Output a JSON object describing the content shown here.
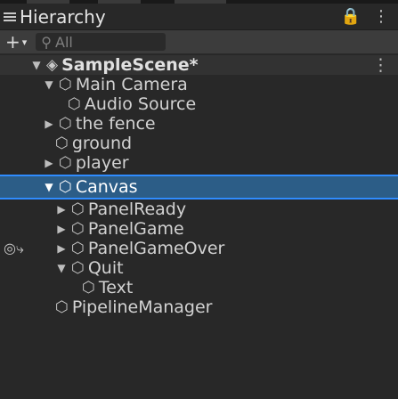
{
  "window": {
    "tab_title": "Hierarchy",
    "lock_icon": "lock-icon",
    "more_icon": "kebab-menu-icon"
  },
  "toolbar": {
    "add_label": "+",
    "search_placeholder": "All"
  },
  "tree": [
    {
      "label": "SampleScene*",
      "depth": 0,
      "expanded": true,
      "icon": "unity-scene-icon"
    },
    {
      "label": "Main Camera",
      "depth": 1,
      "expanded": true,
      "icon": "gameobject-icon"
    },
    {
      "label": "Audio Source",
      "depth": 2,
      "icon": "gameobject-icon"
    },
    {
      "label": "the fence",
      "depth": 1,
      "expanded": false,
      "icon": "gameobject-icon"
    },
    {
      "label": "ground",
      "depth": 1,
      "icon": "gameobject-icon"
    },
    {
      "label": "player",
      "depth": 1,
      "expanded": false,
      "icon": "gameobject-icon"
    },
    {
      "label": "Canvas",
      "depth": 1,
      "expanded": true,
      "icon": "gameobject-icon",
      "selected": true
    },
    {
      "label": "PanelReady",
      "depth": 2,
      "expanded": false,
      "icon": "gameobject-icon"
    },
    {
      "label": "PanelGame",
      "depth": 2,
      "expanded": false,
      "icon": "gameobject-icon"
    },
    {
      "label": "PanelGameOver",
      "depth": 2,
      "expanded": false,
      "icon": "gameobject-icon"
    },
    {
      "label": "Quit",
      "depth": 2,
      "expanded": true,
      "icon": "gameobject-icon"
    },
    {
      "label": "Text",
      "depth": 3,
      "icon": "gameobject-icon"
    },
    {
      "label": "PipelineManager",
      "depth": 1,
      "icon": "gameobject-icon"
    }
  ],
  "colors": {
    "background": "#282828",
    "selection": "#2c5d87",
    "selection_border": "#2f8cff",
    "toolbar": "#3c3c3c"
  }
}
